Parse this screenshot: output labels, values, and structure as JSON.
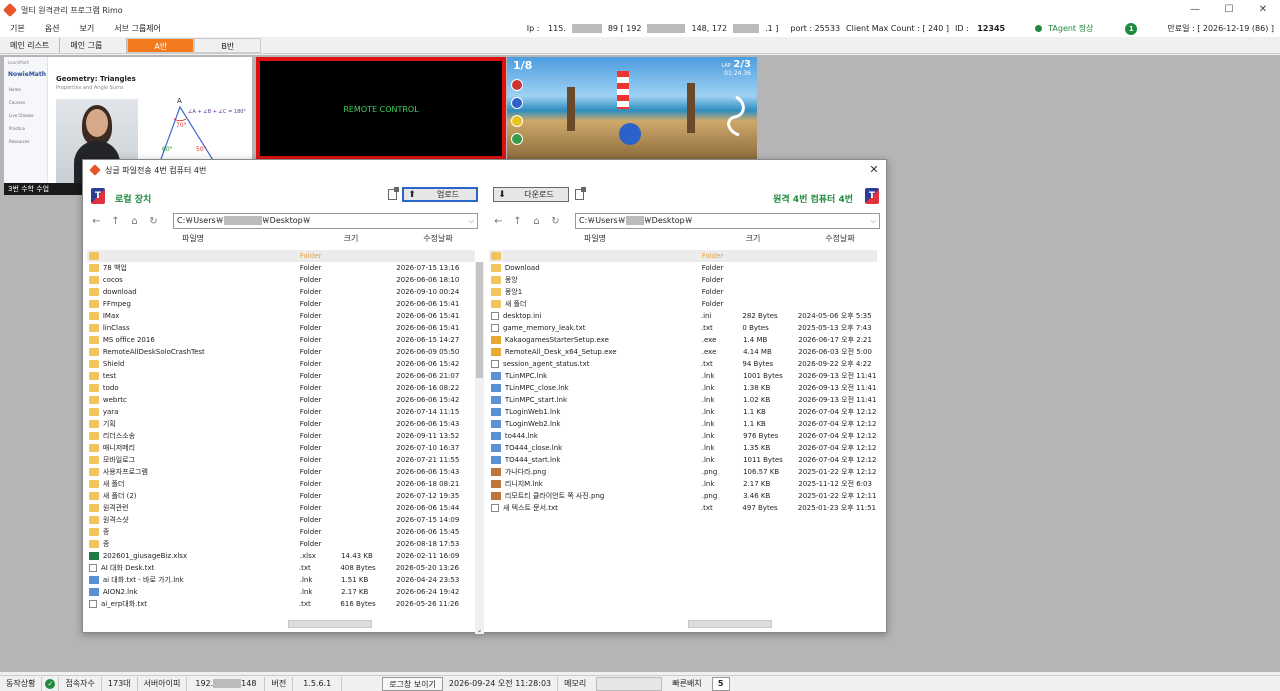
{
  "app": {
    "title": "멀티 원격관리 프로그램 Rimo",
    "win_min": "—",
    "win_max": "☐",
    "win_close": "✕"
  },
  "menu": [
    "기본",
    "옵션",
    "보기",
    "서브 그룹제어"
  ],
  "header_status": {
    "ip_label": "Ip :",
    "ip_value_a": "115.",
    "ip_value_b": "89 [ 192",
    "ip_value_c": "148, 172",
    "ip_value_d": ".1 ]",
    "port": "port : 25533",
    "client_max": "Client Max Count :  [ 240 ]",
    "id_label": "ID :",
    "id_value": "12345",
    "tagent": "TAgent 정상",
    "badge": "1",
    "expire": "만료일 : [ 2026-12-19 (86) ]"
  },
  "tabs": {
    "main_list": "메인 리스트",
    "main_group": "메인 그룹",
    "group_a": "A반",
    "group_b": "B반"
  },
  "thumbnails": {
    "thumb1": {
      "brand": "NowieMath",
      "logo_small": "LearnMath",
      "nav": [
        "Home",
        "Courses",
        "Live Classes",
        "Practice",
        "Resources"
      ],
      "lesson_title": "Geometry: Triangles",
      "lesson_sub": "Properties and Angle Sums",
      "formula": "∠A + ∠B + ∠C = 180°",
      "vertex": "A",
      "angle_a": "70°",
      "angle_b": "60°",
      "angle_c": "50°",
      "caption": "3번 수학 수업"
    },
    "thumb2": {
      "label": "REMOTE CONTROL"
    },
    "thumb3": {
      "position": "1/8",
      "lap_label": "LAP",
      "lap": "2/3",
      "time": "01:24.36"
    }
  },
  "dialog": {
    "title": "싱글 파일전송 4번 컴퓨터 4번",
    "close": "✕",
    "left": {
      "label": "로컬 장치",
      "upload": "업로드",
      "path_a": "C:￦Users￦",
      "path_b": "￦Desktop￦",
      "col_name": "파일명",
      "col_size": "크기",
      "col_date": "수정날짜",
      "rows": [
        {
          "name": "",
          "type": "Folder",
          "size": "",
          "date": "",
          "icon": "folder"
        },
        {
          "name": "78 백업",
          "type": "Folder",
          "size": "",
          "date": "2026-07-15 13:16",
          "icon": "folder"
        },
        {
          "name": "cocos",
          "type": "Folder",
          "size": "",
          "date": "2026-06-06 18:10",
          "icon": "folder"
        },
        {
          "name": "download",
          "type": "Folder",
          "size": "",
          "date": "2026-09-10 00:24",
          "icon": "folder"
        },
        {
          "name": "FFmpeg",
          "type": "Folder",
          "size": "",
          "date": "2026-06-06 15:41",
          "icon": "folder"
        },
        {
          "name": "IMax",
          "type": "Folder",
          "size": "",
          "date": "2026-06-06 15:41",
          "icon": "folder"
        },
        {
          "name": "linClass",
          "type": "Folder",
          "size": "",
          "date": "2026-06-06 15:41",
          "icon": "folder"
        },
        {
          "name": "MS office 2016",
          "type": "Folder",
          "size": "",
          "date": "2026-06-15 14:27",
          "icon": "folder"
        },
        {
          "name": "RemoteAllDeskSoloCrashTest",
          "type": "Folder",
          "size": "",
          "date": "2026-06-09 05:50",
          "icon": "folder"
        },
        {
          "name": "Shield",
          "type": "Folder",
          "size": "",
          "date": "2026-06-06 15:42",
          "icon": "folder"
        },
        {
          "name": "test",
          "type": "Folder",
          "size": "",
          "date": "2026-06-06 21:07",
          "icon": "folder"
        },
        {
          "name": "todo",
          "type": "Folder",
          "size": "",
          "date": "2026-06-16 08:22",
          "icon": "folder"
        },
        {
          "name": "webrtc",
          "type": "Folder",
          "size": "",
          "date": "2026-06-06 15:42",
          "icon": "folder"
        },
        {
          "name": "yara",
          "type": "Folder",
          "size": "",
          "date": "2026-07-14 11:15",
          "icon": "folder"
        },
        {
          "name": "기획",
          "type": "Folder",
          "size": "",
          "date": "2026-06-06 15:43",
          "icon": "folder"
        },
        {
          "name": "리더스소송",
          "type": "Folder",
          "size": "",
          "date": "2026-09-11 13:52",
          "icon": "folder"
        },
        {
          "name": "매니저메리",
          "type": "Folder",
          "size": "",
          "date": "2026-07-10 16:37",
          "icon": "folder"
        },
        {
          "name": "모바일로그",
          "type": "Folder",
          "size": "",
          "date": "2026-07-21 11:55",
          "icon": "folder"
        },
        {
          "name": "사용자프로그램",
          "type": "Folder",
          "size": "",
          "date": "2026-06-06 15:43",
          "icon": "folder"
        },
        {
          "name": "새 폴더",
          "type": "Folder",
          "size": "",
          "date": "2026-06-18 08:21",
          "icon": "folder"
        },
        {
          "name": "새 폴더 (2)",
          "type": "Folder",
          "size": "",
          "date": "2026-07-12 19:35",
          "icon": "folder"
        },
        {
          "name": "원격관련",
          "type": "Folder",
          "size": "",
          "date": "2026-06-06 15:44",
          "icon": "folder"
        },
        {
          "name": "원격스샷",
          "type": "Folder",
          "size": "",
          "date": "2026-07-15 14:09",
          "icon": "folder"
        },
        {
          "name": "종",
          "type": "Folder",
          "size": "",
          "date": "2026-06-06 15:45",
          "icon": "folder"
        },
        {
          "name": "종",
          "type": "Folder",
          "size": "",
          "date": "2026-08-18 17:53",
          "icon": "folder"
        },
        {
          "name": "202601_giusageBiz.xlsx",
          "type": ".xlsx",
          "size": "14.43 KB",
          "date": "2026-02-11 16:09",
          "icon": "xlsx"
        },
        {
          "name": "AI 대화 Desk.txt",
          "type": ".txt",
          "size": "408 Bytes",
          "date": "2026-05-20 13:26",
          "icon": "file"
        },
        {
          "name": "ai 대화.txt - 바로 가기.lnk",
          "type": ".lnk",
          "size": "1.51 KB",
          "date": "2026-04-24 23:53",
          "icon": "lnk"
        },
        {
          "name": "AION2.lnk",
          "type": ".lnk",
          "size": "2.17 KB",
          "date": "2026-06-24 19:42",
          "icon": "lnk"
        },
        {
          "name": "ai_erp대화.txt",
          "type": ".txt",
          "size": "616 Bytes",
          "date": "2026-05-26 11:26",
          "icon": "file"
        }
      ]
    },
    "right": {
      "label": "원격 4번 컴퓨터 4번",
      "download": "다운로드",
      "path_a": "C:￦Users￦",
      "path_b": "￦Desktop￦",
      "col_name": "파일명",
      "col_size": "크기",
      "col_date": "수정날짜",
      "rows": [
        {
          "name": "",
          "type": "Folder",
          "size": "",
          "date": "",
          "icon": "folder"
        },
        {
          "name": "Download",
          "type": "Folder",
          "size": "",
          "date": "",
          "icon": "folder"
        },
        {
          "name": "몽앙",
          "type": "Folder",
          "size": "",
          "date": "",
          "icon": "folder"
        },
        {
          "name": "몽앙1",
          "type": "Folder",
          "size": "",
          "date": "",
          "icon": "folder"
        },
        {
          "name": "새 폴더",
          "type": "Folder",
          "size": "",
          "date": "",
          "icon": "folder"
        },
        {
          "name": "desktop.ini",
          "type": ".ini",
          "size": "282 Bytes",
          "date": "2024-05-06 오후 5:35",
          "icon": "file"
        },
        {
          "name": "game_memory_leak.txt",
          "type": ".txt",
          "size": "0 Bytes",
          "date": "2025-05-13 오후 7:43",
          "icon": "file"
        },
        {
          "name": "KakaogamesStarterSetup.exe",
          "type": ".exe",
          "size": "1.4 MB",
          "date": "2026-06-17 오후 2:21",
          "icon": "exe"
        },
        {
          "name": "RemoteAll_Desk_x64_Setup.exe",
          "type": ".exe",
          "size": "4.14 MB",
          "date": "2026-06-03 오전 5:00",
          "icon": "exe"
        },
        {
          "name": "session_agent_status.txt",
          "type": ".txt",
          "size": "94 Bytes",
          "date": "2026-09-22 오후 4:22",
          "icon": "file"
        },
        {
          "name": "TLinMPC.lnk",
          "type": ".lnk",
          "size": "1001 Bytes",
          "date": "2026-09-13 오전 11:41",
          "icon": "lnk"
        },
        {
          "name": "TLinMPC_close.lnk",
          "type": ".lnk",
          "size": "1.38 KB",
          "date": "2026-09-13 오전 11:41",
          "icon": "lnk"
        },
        {
          "name": "TLinMPC_start.lnk",
          "type": ".lnk",
          "size": "1.02 KB",
          "date": "2026-09-13 오전 11:41",
          "icon": "lnk"
        },
        {
          "name": "TLoginWeb1.lnk",
          "type": ".lnk",
          "size": "1.1 KB",
          "date": "2026-07-04 오후 12:12",
          "icon": "lnk"
        },
        {
          "name": "TLoginWeb2.lnk",
          "type": ".lnk",
          "size": "1.1 KB",
          "date": "2026-07-04 오후 12:12",
          "icon": "lnk"
        },
        {
          "name": "to444.lnk",
          "type": ".lnk",
          "size": "976 Bytes",
          "date": "2026-07-04 오후 12:12",
          "icon": "lnk"
        },
        {
          "name": "TO444_close.lnk",
          "type": ".lnk",
          "size": "1.35 KB",
          "date": "2026-07-04 오후 12:12",
          "icon": "lnk"
        },
        {
          "name": "TO444_start.lnk",
          "type": ".lnk",
          "size": "1011 Bytes",
          "date": "2026-07-04 오후 12:12",
          "icon": "lnk"
        },
        {
          "name": "가나다라.png",
          "type": ".png",
          "size": "106.57 KB",
          "date": "2025-01-22 오후 12:12",
          "icon": "png"
        },
        {
          "name": "리니지M.lnk",
          "type": ".lnk",
          "size": "2.17 KB",
          "date": "2025-11-12 오전 6:03",
          "icon": "png"
        },
        {
          "name": "리모트티 클라이언트 쪽 사진.png",
          "type": ".png",
          "size": "3.46 KB",
          "date": "2025-01-22 오후 12:11",
          "icon": "png"
        },
        {
          "name": "새 텍스트 문서.txt",
          "type": ".txt",
          "size": "497 Bytes",
          "date": "2025-01-23 오후 11:51",
          "icon": "file"
        }
      ]
    }
  },
  "statusbar": {
    "state_label": "동작상황",
    "conn_label": "접속자수",
    "conn_value": "173대",
    "server_ip_label": "서버아이피",
    "server_ip_a": "192.",
    "server_ip_b": "148",
    "version_label": "버전",
    "version_value": "1.5.6.1",
    "log_button": "로그창 보이기",
    "datetime": "2026-09-24 오전 11:28:03",
    "memory_label": "메모리",
    "quick_label": "빠른배치",
    "quick_value": "5"
  }
}
